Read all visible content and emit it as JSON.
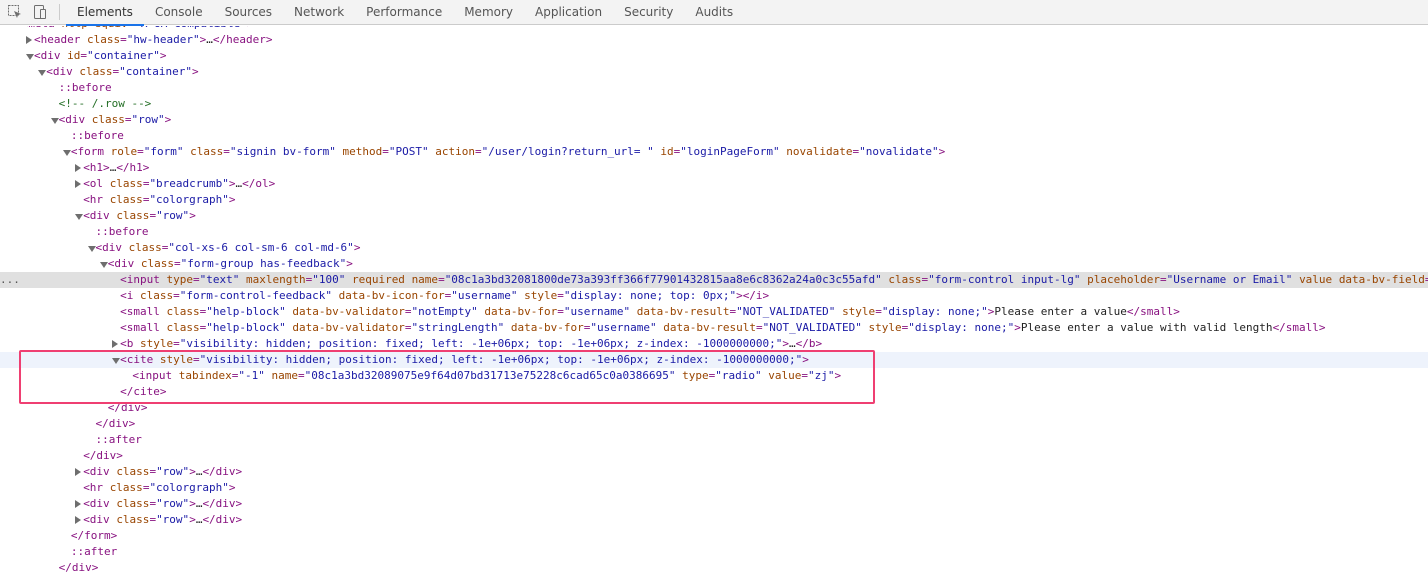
{
  "toolbar": {
    "inspect_icon": "inspect-element-icon",
    "device_icon": "device-toolbar-icon",
    "tabs": [
      {
        "label": "Elements",
        "active": true
      },
      {
        "label": "Console"
      },
      {
        "label": "Sources"
      },
      {
        "label": "Network"
      },
      {
        "label": "Performance"
      },
      {
        "label": "Memory"
      },
      {
        "label": "Application"
      },
      {
        "label": "Security"
      },
      {
        "label": "Audits"
      }
    ]
  },
  "colors": {
    "tag": "#881280",
    "attr_name": "#994500",
    "attr_value": "#1a1aa6",
    "comment": "#236e25",
    "highlight": "#ef3f72",
    "selected_row": "#e0e0e0"
  },
  "selected_row_menu": "...",
  "dom_tree": [
    {
      "indent": 0,
      "toggle": "none",
      "parts": [
        [
          "tag",
          "<"
        ],
        [
          "tag",
          "meta"
        ],
        [
          "tag",
          " "
        ],
        [
          "attr",
          "http-equiv"
        ],
        [
          "tag",
          "="
        ],
        [
          "val",
          "\"X-UA-Compatible\""
        ],
        [
          "tag",
          ">"
        ]
      ]
    },
    {
      "indent": 1,
      "toggle": "right",
      "parts": [
        [
          "tag",
          "<header"
        ],
        [
          "tag",
          " "
        ],
        [
          "attr",
          "class"
        ],
        [
          "tag",
          "="
        ],
        [
          "val",
          "\"hw-header\""
        ],
        [
          "tag",
          ">"
        ],
        [
          "ell",
          "…"
        ],
        [
          "tag",
          "</header>"
        ]
      ]
    },
    {
      "indent": 1,
      "toggle": "down",
      "parts": [
        [
          "tag",
          "<div"
        ],
        [
          "tag",
          " "
        ],
        [
          "attr",
          "id"
        ],
        [
          "tag",
          "="
        ],
        [
          "val",
          "\"container\""
        ],
        [
          "tag",
          ">"
        ]
      ]
    },
    {
      "indent": 2,
      "toggle": "down",
      "parts": [
        [
          "tag",
          "<div"
        ],
        [
          "tag",
          " "
        ],
        [
          "attr",
          "class"
        ],
        [
          "tag",
          "="
        ],
        [
          "val",
          "\"container\""
        ],
        [
          "tag",
          ">"
        ]
      ]
    },
    {
      "indent": 3,
      "toggle": "none",
      "parts": [
        [
          "pseudo",
          "::before"
        ]
      ]
    },
    {
      "indent": 3,
      "toggle": "none",
      "parts": [
        [
          "comment",
          "<!-- /.row -->"
        ]
      ]
    },
    {
      "indent": 3,
      "toggle": "down",
      "parts": [
        [
          "tag",
          "<div"
        ],
        [
          "tag",
          " "
        ],
        [
          "attr",
          "class"
        ],
        [
          "tag",
          "="
        ],
        [
          "val",
          "\"row\""
        ],
        [
          "tag",
          ">"
        ]
      ]
    },
    {
      "indent": 4,
      "toggle": "none",
      "parts": [
        [
          "pseudo",
          "::before"
        ]
      ]
    },
    {
      "indent": 4,
      "toggle": "down",
      "parts": [
        [
          "tag",
          "<form"
        ],
        [
          "tag",
          " "
        ],
        [
          "attr",
          "role"
        ],
        [
          "tag",
          "="
        ],
        [
          "val",
          "\"form\""
        ],
        [
          "tag",
          " "
        ],
        [
          "attr",
          "class"
        ],
        [
          "tag",
          "="
        ],
        [
          "val",
          "\"signin bv-form\""
        ],
        [
          "tag",
          " "
        ],
        [
          "attr",
          "method"
        ],
        [
          "tag",
          "="
        ],
        [
          "val",
          "\"POST\""
        ],
        [
          "tag",
          " "
        ],
        [
          "attr",
          "action"
        ],
        [
          "tag",
          "="
        ],
        [
          "val",
          "\"/user/login?return_url= \""
        ],
        [
          "tag",
          " "
        ],
        [
          "attr",
          "id"
        ],
        [
          "tag",
          "="
        ],
        [
          "val",
          "\"loginPageForm\""
        ],
        [
          "tag",
          " "
        ],
        [
          "attr",
          "novalidate"
        ],
        [
          "tag",
          "="
        ],
        [
          "val",
          "\"novalidate\""
        ],
        [
          "tag",
          ">"
        ]
      ]
    },
    {
      "indent": 5,
      "toggle": "right",
      "parts": [
        [
          "tag",
          "<h1>"
        ],
        [
          "ell",
          "…"
        ],
        [
          "tag",
          "</h1>"
        ]
      ]
    },
    {
      "indent": 5,
      "toggle": "right",
      "parts": [
        [
          "tag",
          "<ol"
        ],
        [
          "tag",
          " "
        ],
        [
          "attr",
          "class"
        ],
        [
          "tag",
          "="
        ],
        [
          "val",
          "\"breadcrumb\""
        ],
        [
          "tag",
          ">"
        ],
        [
          "ell",
          "…"
        ],
        [
          "tag",
          "</ol>"
        ]
      ]
    },
    {
      "indent": 5,
      "toggle": "none",
      "parts": [
        [
          "tag",
          "<hr"
        ],
        [
          "tag",
          " "
        ],
        [
          "attr",
          "class"
        ],
        [
          "tag",
          "="
        ],
        [
          "val",
          "\"colorgraph\""
        ],
        [
          "tag",
          ">"
        ]
      ]
    },
    {
      "indent": 5,
      "toggle": "down",
      "parts": [
        [
          "tag",
          "<div"
        ],
        [
          "tag",
          " "
        ],
        [
          "attr",
          "class"
        ],
        [
          "tag",
          "="
        ],
        [
          "val",
          "\"row\""
        ],
        [
          "tag",
          ">"
        ]
      ]
    },
    {
      "indent": 6,
      "toggle": "none",
      "parts": [
        [
          "pseudo",
          "::before"
        ]
      ]
    },
    {
      "indent": 6,
      "toggle": "down",
      "parts": [
        [
          "tag",
          "<div"
        ],
        [
          "tag",
          " "
        ],
        [
          "attr",
          "class"
        ],
        [
          "tag",
          "="
        ],
        [
          "val",
          "\"col-xs-6 col-sm-6 col-md-6\""
        ],
        [
          "tag",
          ">"
        ]
      ]
    },
    {
      "indent": 7,
      "toggle": "down",
      "parts": [
        [
          "tag",
          "<div"
        ],
        [
          "tag",
          " "
        ],
        [
          "attr",
          "class"
        ],
        [
          "tag",
          "="
        ],
        [
          "val",
          "\"form-group has-feedback\""
        ],
        [
          "tag",
          ">"
        ]
      ]
    },
    {
      "indent": 8,
      "toggle": "none",
      "selected": true,
      "parts": [
        [
          "tag",
          "<input"
        ],
        [
          "tag",
          " "
        ],
        [
          "attr",
          "type"
        ],
        [
          "tag",
          "="
        ],
        [
          "val",
          "\"text\""
        ],
        [
          "tag",
          " "
        ],
        [
          "attr",
          "maxlength"
        ],
        [
          "tag",
          "="
        ],
        [
          "val",
          "\"100\""
        ],
        [
          "tag",
          " "
        ],
        [
          "attr",
          "required"
        ],
        [
          "tag",
          " "
        ],
        [
          "attr",
          "name"
        ],
        [
          "tag",
          "="
        ],
        [
          "val",
          "\"08c1a3bd32081800de73a393ff366f77901432815aa8e6c8362a24a0c3c55afd\""
        ],
        [
          "tag",
          " "
        ],
        [
          "attr",
          "class"
        ],
        [
          "tag",
          "="
        ],
        [
          "val",
          "\"form-control input-lg\""
        ],
        [
          "tag",
          " "
        ],
        [
          "attr",
          "placeholder"
        ],
        [
          "tag",
          "="
        ],
        [
          "val",
          "\"Username or Email\""
        ],
        [
          "tag",
          " "
        ],
        [
          "attr",
          "value"
        ],
        [
          "tag",
          " "
        ],
        [
          "attr",
          "data-bv-field"
        ],
        [
          "tag",
          "="
        ],
        [
          "val",
          "\""
        ]
      ]
    },
    {
      "indent": 8,
      "toggle": "none",
      "parts": [
        [
          "tag",
          "<i"
        ],
        [
          "tag",
          " "
        ],
        [
          "attr",
          "class"
        ],
        [
          "tag",
          "="
        ],
        [
          "val",
          "\"form-control-feedback\""
        ],
        [
          "tag",
          " "
        ],
        [
          "attr",
          "data-bv-icon-for"
        ],
        [
          "tag",
          "="
        ],
        [
          "val",
          "\"username\""
        ],
        [
          "tag",
          " "
        ],
        [
          "attr",
          "style"
        ],
        [
          "tag",
          "="
        ],
        [
          "val",
          "\"display: none; top: 0px;\""
        ],
        [
          "tag",
          ">"
        ],
        [
          "tag",
          "</i>"
        ]
      ]
    },
    {
      "indent": 8,
      "toggle": "none",
      "parts": [
        [
          "tag",
          "<small"
        ],
        [
          "tag",
          " "
        ],
        [
          "attr",
          "class"
        ],
        [
          "tag",
          "="
        ],
        [
          "val",
          "\"help-block\""
        ],
        [
          "tag",
          " "
        ],
        [
          "attr",
          "data-bv-validator"
        ],
        [
          "tag",
          "="
        ],
        [
          "val",
          "\"notEmpty\""
        ],
        [
          "tag",
          " "
        ],
        [
          "attr",
          "data-bv-for"
        ],
        [
          "tag",
          "="
        ],
        [
          "val",
          "\"username\""
        ],
        [
          "tag",
          " "
        ],
        [
          "attr",
          "data-bv-result"
        ],
        [
          "tag",
          "="
        ],
        [
          "val",
          "\"NOT_VALIDATED\""
        ],
        [
          "tag",
          " "
        ],
        [
          "attr",
          "style"
        ],
        [
          "tag",
          "="
        ],
        [
          "val",
          "\"display: none;\""
        ],
        [
          "tag",
          ">"
        ],
        [
          "txt",
          "Please enter a value"
        ],
        [
          "tag",
          "</small>"
        ]
      ]
    },
    {
      "indent": 8,
      "toggle": "none",
      "parts": [
        [
          "tag",
          "<small"
        ],
        [
          "tag",
          " "
        ],
        [
          "attr",
          "class"
        ],
        [
          "tag",
          "="
        ],
        [
          "val",
          "\"help-block\""
        ],
        [
          "tag",
          " "
        ],
        [
          "attr",
          "data-bv-validator"
        ],
        [
          "tag",
          "="
        ],
        [
          "val",
          "\"stringLength\""
        ],
        [
          "tag",
          " "
        ],
        [
          "attr",
          "data-bv-for"
        ],
        [
          "tag",
          "="
        ],
        [
          "val",
          "\"username\""
        ],
        [
          "tag",
          " "
        ],
        [
          "attr",
          "data-bv-result"
        ],
        [
          "tag",
          "="
        ],
        [
          "val",
          "\"NOT_VALIDATED\""
        ],
        [
          "tag",
          " "
        ],
        [
          "attr",
          "style"
        ],
        [
          "tag",
          "="
        ],
        [
          "val",
          "\"display: none;\""
        ],
        [
          "tag",
          ">"
        ],
        [
          "txt",
          "Please enter a value with valid length"
        ],
        [
          "tag",
          "</small>"
        ]
      ]
    },
    {
      "indent": 8,
      "toggle": "right",
      "parts": [
        [
          "tag",
          "<b"
        ],
        [
          "tag",
          " "
        ],
        [
          "attr",
          "style"
        ],
        [
          "tag",
          "="
        ],
        [
          "val",
          "\"visibility: hidden; position: fixed; left: -1e+06px; top: -1e+06px; z-index: -1000000000;\""
        ],
        [
          "tag",
          ">"
        ],
        [
          "ell",
          "…"
        ],
        [
          "tag",
          "</b>"
        ]
      ]
    },
    {
      "indent": 8,
      "toggle": "down",
      "hovered": true,
      "parts": [
        [
          "tag",
          "<cite"
        ],
        [
          "tag",
          " "
        ],
        [
          "attr",
          "style"
        ],
        [
          "tag",
          "="
        ],
        [
          "val",
          "\"visibility: hidden; position: fixed; left: -1e+06px; top: -1e+06px; z-index: -1000000000;\""
        ],
        [
          "tag",
          ">"
        ]
      ]
    },
    {
      "indent": 9,
      "toggle": "none",
      "parts": [
        [
          "tag",
          "<input"
        ],
        [
          "tag",
          " "
        ],
        [
          "attr",
          "tabindex"
        ],
        [
          "tag",
          "="
        ],
        [
          "val",
          "\"-1\""
        ],
        [
          "tag",
          " "
        ],
        [
          "attr",
          "name"
        ],
        [
          "tag",
          "="
        ],
        [
          "val",
          "\"08c1a3bd32089075e9f64d07bd31713e75228c6cad65c0a0386695\""
        ],
        [
          "tag",
          " "
        ],
        [
          "attr",
          "type"
        ],
        [
          "tag",
          "="
        ],
        [
          "val",
          "\"radio\""
        ],
        [
          "tag",
          " "
        ],
        [
          "attr",
          "value"
        ],
        [
          "tag",
          "="
        ],
        [
          "val",
          "\"zj\""
        ],
        [
          "tag",
          ">"
        ]
      ]
    },
    {
      "indent": 8,
      "toggle": "none",
      "parts": [
        [
          "tag",
          "</cite>"
        ]
      ]
    },
    {
      "indent": 7,
      "toggle": "none",
      "parts": [
        [
          "tag",
          "</div>"
        ]
      ]
    },
    {
      "indent": 6,
      "toggle": "none",
      "parts": [
        [
          "tag",
          "</div>"
        ]
      ]
    },
    {
      "indent": 6,
      "toggle": "none",
      "parts": [
        [
          "pseudo",
          "::after"
        ]
      ]
    },
    {
      "indent": 5,
      "toggle": "none",
      "parts": [
        [
          "tag",
          "</div>"
        ]
      ]
    },
    {
      "indent": 5,
      "toggle": "right",
      "parts": [
        [
          "tag",
          "<div"
        ],
        [
          "tag",
          " "
        ],
        [
          "attr",
          "class"
        ],
        [
          "tag",
          "="
        ],
        [
          "val",
          "\"row\""
        ],
        [
          "tag",
          ">"
        ],
        [
          "ell",
          "…"
        ],
        [
          "tag",
          "</div>"
        ]
      ]
    },
    {
      "indent": 5,
      "toggle": "none",
      "parts": [
        [
          "tag",
          "<hr"
        ],
        [
          "tag",
          " "
        ],
        [
          "attr",
          "class"
        ],
        [
          "tag",
          "="
        ],
        [
          "val",
          "\"colorgraph\""
        ],
        [
          "tag",
          ">"
        ]
      ]
    },
    {
      "indent": 5,
      "toggle": "right",
      "parts": [
        [
          "tag",
          "<div"
        ],
        [
          "tag",
          " "
        ],
        [
          "attr",
          "class"
        ],
        [
          "tag",
          "="
        ],
        [
          "val",
          "\"row\""
        ],
        [
          "tag",
          ">"
        ],
        [
          "ell",
          "…"
        ],
        [
          "tag",
          "</div>"
        ]
      ]
    },
    {
      "indent": 5,
      "toggle": "right",
      "parts": [
        [
          "tag",
          "<div"
        ],
        [
          "tag",
          " "
        ],
        [
          "attr",
          "class"
        ],
        [
          "tag",
          "="
        ],
        [
          "val",
          "\"row\""
        ],
        [
          "tag",
          ">"
        ],
        [
          "ell",
          "…"
        ],
        [
          "tag",
          "</div>"
        ]
      ]
    },
    {
      "indent": 4,
      "toggle": "none",
      "parts": [
        [
          "tag",
          "</form>"
        ]
      ]
    },
    {
      "indent": 4,
      "toggle": "none",
      "parts": [
        [
          "pseudo",
          "::after"
        ]
      ]
    },
    {
      "indent": 3,
      "toggle": "none",
      "parts": [
        [
          "tag",
          "</div>"
        ]
      ]
    }
  ]
}
